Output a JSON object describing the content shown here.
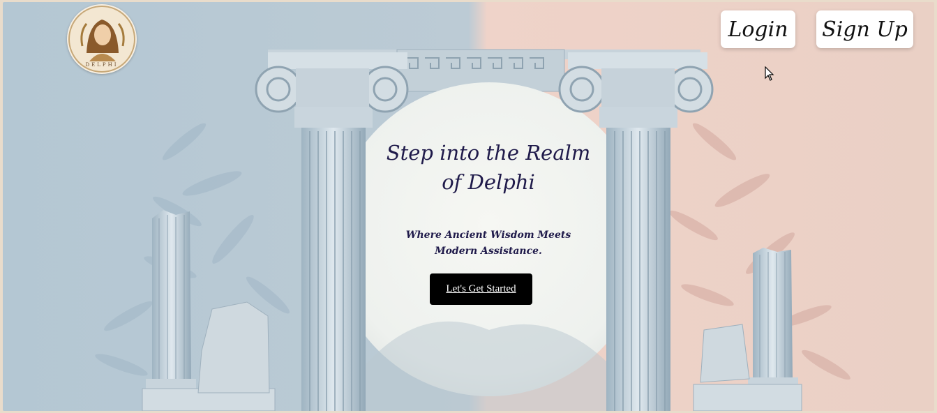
{
  "logo": {
    "text": "DELPHI"
  },
  "header": {
    "login_label": "Login",
    "signup_label": "Sign Up"
  },
  "hero": {
    "title": "Step into the Realm of Delphi",
    "subtitle": "Where Ancient Wisdom Meets Modern Assistance.",
    "cta_label": "Let's Get Started"
  },
  "colors": {
    "left_bg": "#b4c7d3",
    "right_bg": "#ead0c5",
    "title_color": "#1f1a4a",
    "cta_bg": "#000000"
  }
}
